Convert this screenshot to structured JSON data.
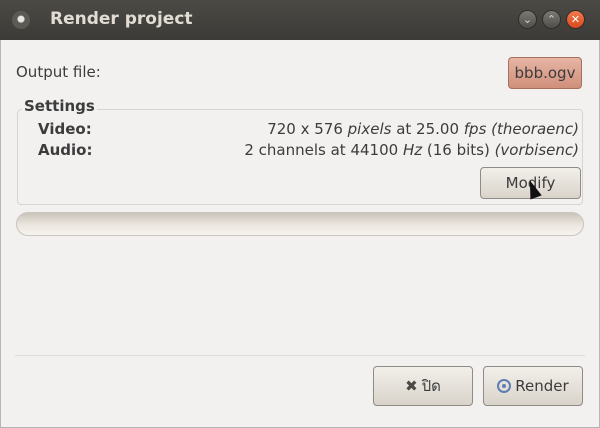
{
  "window": {
    "title": "Render project",
    "controls": {
      "minimize": "⌄",
      "maximize": "⌃",
      "close": "✕"
    }
  },
  "output": {
    "label": "Output file:",
    "file_button": "bbb.ogv"
  },
  "settings": {
    "title": "Settings",
    "video": {
      "label": "Video:",
      "value_prefix": "720 x 576 ",
      "unit1": "pixels",
      "mid": " at 25.00 ",
      "unit2": "fps",
      "codec": " (theoraenc)"
    },
    "audio": {
      "label": "Audio:",
      "value_prefix": "2 channels at 44100 ",
      "unit1": "Hz",
      "mid": " (16 bits) ",
      "codec": "(vorbisenc)"
    },
    "modify_button": "Modify"
  },
  "progress": {
    "value": 0
  },
  "actions": {
    "close_button": "ปิด",
    "close_icon": "close-icon",
    "render_button": "Render",
    "render_icon": "render-icon"
  }
}
